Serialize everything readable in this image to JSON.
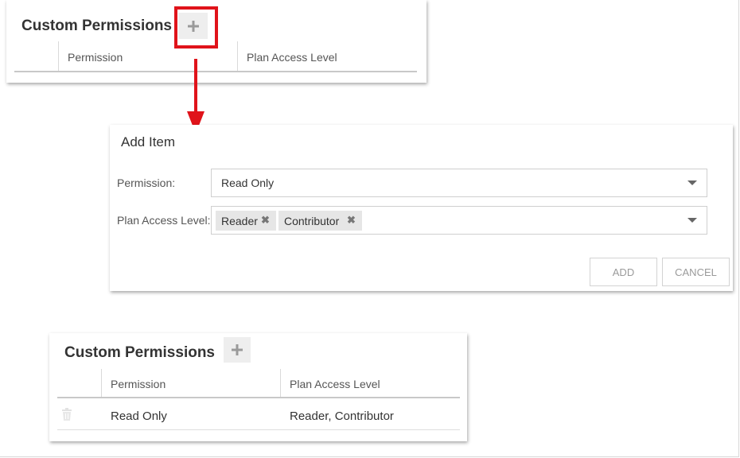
{
  "top_panel": {
    "title": "Custom Permissions",
    "add_icon": "plus-icon",
    "columns": [
      "Permission",
      "Plan Access Level"
    ]
  },
  "annotation": {
    "highlight_color": "#e0131a",
    "arrow_color": "#e0131a"
  },
  "dialog": {
    "title": "Add Item",
    "permission_label": "Permission:",
    "permission_value": "Read Only",
    "plan_access_label": "Plan Access Level:",
    "plan_access_chips": [
      "Reader",
      "Contributor"
    ],
    "chip_remove_glyph": "✖",
    "add_button": "ADD",
    "cancel_button": "CANCEL"
  },
  "bottom_panel": {
    "title": "Custom Permissions",
    "add_icon": "plus-icon",
    "columns": [
      "Permission",
      "Plan Access Level"
    ],
    "rows": [
      {
        "delete_icon": "trash-icon",
        "permission": "Read Only",
        "plan_access_level": "Reader, Contributor"
      }
    ]
  }
}
